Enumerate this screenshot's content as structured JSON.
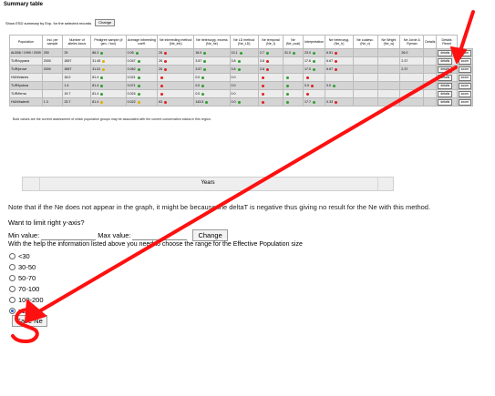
{
  "page": {
    "title": "Summary table"
  },
  "top_controls": {
    "text": "Show  ESD  summary  by  Exp.  for  the  selected  records",
    "button": "Change"
  },
  "table": {
    "headers": [
      "Population",
      "Ind. per sample",
      "Number of alleles locus",
      "Pedigree sample (# gen. / loci)",
      "Average inbreeding coeff.",
      "Ne inbreeding method (Ne_inb)",
      "Ne heterozyg. excess (Ne_he)",
      "Ne LD method (Ne_LD)",
      "Ne temporal (Ne_t)",
      "Ne (Ne_coal)",
      "Interpretation",
      "Ne heterozyg. (Ne_h)",
      "Ne coalesc. (Ne_c)",
      "Ne Wright (Ne_w)",
      "Ne Jorde & Ryman",
      "Details",
      "Details Reset"
    ],
    "rows": [
      {
        "name": "ALB08 / 1999 / 2009",
        "v": [
          "250",
          "29",
          "86.3",
          "0.05",
          "26",
          "16.0",
          "13.1",
          "2.7",
          "31.0",
          "23.0",
          "6.51",
          "",
          "",
          "26.0",
          ""
        ],
        "dots": [
          "",
          "",
          "g",
          "g",
          "r",
          "g",
          "g",
          "g",
          "g",
          "g",
          "r",
          "",
          "",
          "",
          ""
        ],
        "btn1": "details",
        "btn2": "zoom"
      },
      {
        "name": "TUR/cypaea",
        "v": [
          "2000",
          "2657",
          "31.45",
          "0.047",
          "26",
          "3.57",
          "3.8",
          "3.8",
          "",
          "17.6",
          "6.67",
          "",
          "",
          "2.37",
          ""
        ],
        "dots": [
          "",
          "",
          "y",
          "g",
          "r",
          "g",
          "g",
          "r",
          "",
          "g",
          "r",
          "",
          "",
          "",
          ""
        ],
        "btn1": "details",
        "btn2": "zoom"
      },
      {
        "name": "TUR/prove",
        "v": [
          "2000",
          "2657",
          "31.51",
          "0.062",
          "26",
          "3.57",
          "3.8",
          "3.8",
          "",
          "17.0",
          "6.67",
          "",
          "",
          "2.37",
          ""
        ],
        "dots": [
          "",
          "",
          "y",
          "g",
          "r",
          "g",
          "g",
          "r",
          "",
          "g",
          "r",
          "",
          "",
          "",
          ""
        ],
        "btn1": "details",
        "btn2": "zoom"
      },
      {
        "name": "HUN/clanes",
        "v": [
          "",
          "18.0",
          "81.4",
          "0.021",
          "",
          "0.0",
          "0.0",
          "",
          "",
          "",
          "",
          "",
          "",
          "",
          ""
        ],
        "dots": [
          "",
          "",
          "g",
          "g",
          "r",
          "g",
          "",
          "r",
          "g",
          "r",
          "",
          "",
          "",
          "",
          ""
        ],
        "btn1": "details",
        "btn2": "zoom"
      },
      {
        "name": "TUR/lyubna",
        "v": [
          "",
          "1.4",
          "81.4",
          "0.071",
          "",
          "0.0",
          "0.0",
          "",
          "",
          "0.0",
          "0.0",
          "",
          "",
          "",
          ""
        ],
        "dots": [
          "",
          "",
          "g",
          "g",
          "r",
          "g",
          "",
          "r",
          "g",
          "r",
          "g",
          "",
          "",
          "",
          ""
        ],
        "btn1": "details",
        "btn2": "zoom"
      },
      {
        "name": "TUR/ferna",
        "v": [
          "",
          "19.7",
          "81.4",
          "0.024",
          "",
          "0.0",
          "0.0",
          "",
          "",
          "",
          "",
          "",
          "",
          "",
          ""
        ],
        "dots": [
          "",
          "",
          "g",
          "g",
          "r",
          "g",
          "",
          "r",
          "g",
          "r",
          "",
          "",
          "",
          "",
          ""
        ],
        "btn1": "details",
        "btn2": "zoom"
      },
      {
        "name": "HUN/halerdi",
        "v": [
          "1.3",
          "23.7",
          "81.4",
          "0.022",
          "63",
          "143.5",
          "0.0",
          "",
          "",
          "17.7",
          "0.33",
          "",
          "",
          "",
          ""
        ],
        "dots": [
          "",
          "",
          "y",
          "y",
          "r",
          "g",
          "g",
          "r",
          "g",
          "g",
          "r",
          "",
          "",
          "",
          ""
        ],
        "btn1": "details",
        "btn2": "zoom"
      }
    ]
  },
  "footnote": "Bold values are the current assessment of which population groups may be associated with the current conservation status in this region.",
  "years_bar": {
    "label": "Years"
  },
  "note": "Note that if the Ne does not appear in the graph, it might be because the deltaT is negative thus giving no result for the Ne with this method.",
  "limit": {
    "question": "Want to limit right y-axis?",
    "min_label": "Min value:",
    "max_label": "Max value:",
    "change_button": "Change"
  },
  "help_text": "With the help the information listed above you need to choose the range for the Effective Population size",
  "radios": [
    {
      "label": "<30",
      "checked": false
    },
    {
      "label": "30-50",
      "checked": false
    },
    {
      "label": "50-70",
      "checked": false
    },
    {
      "label": "70-100",
      "checked": false
    },
    {
      "label": "100-200",
      "checked": false
    },
    {
      "label": ">200",
      "checked": true
    }
  ],
  "save_button": "Save Ne",
  "annotation_color": "#ff1010"
}
